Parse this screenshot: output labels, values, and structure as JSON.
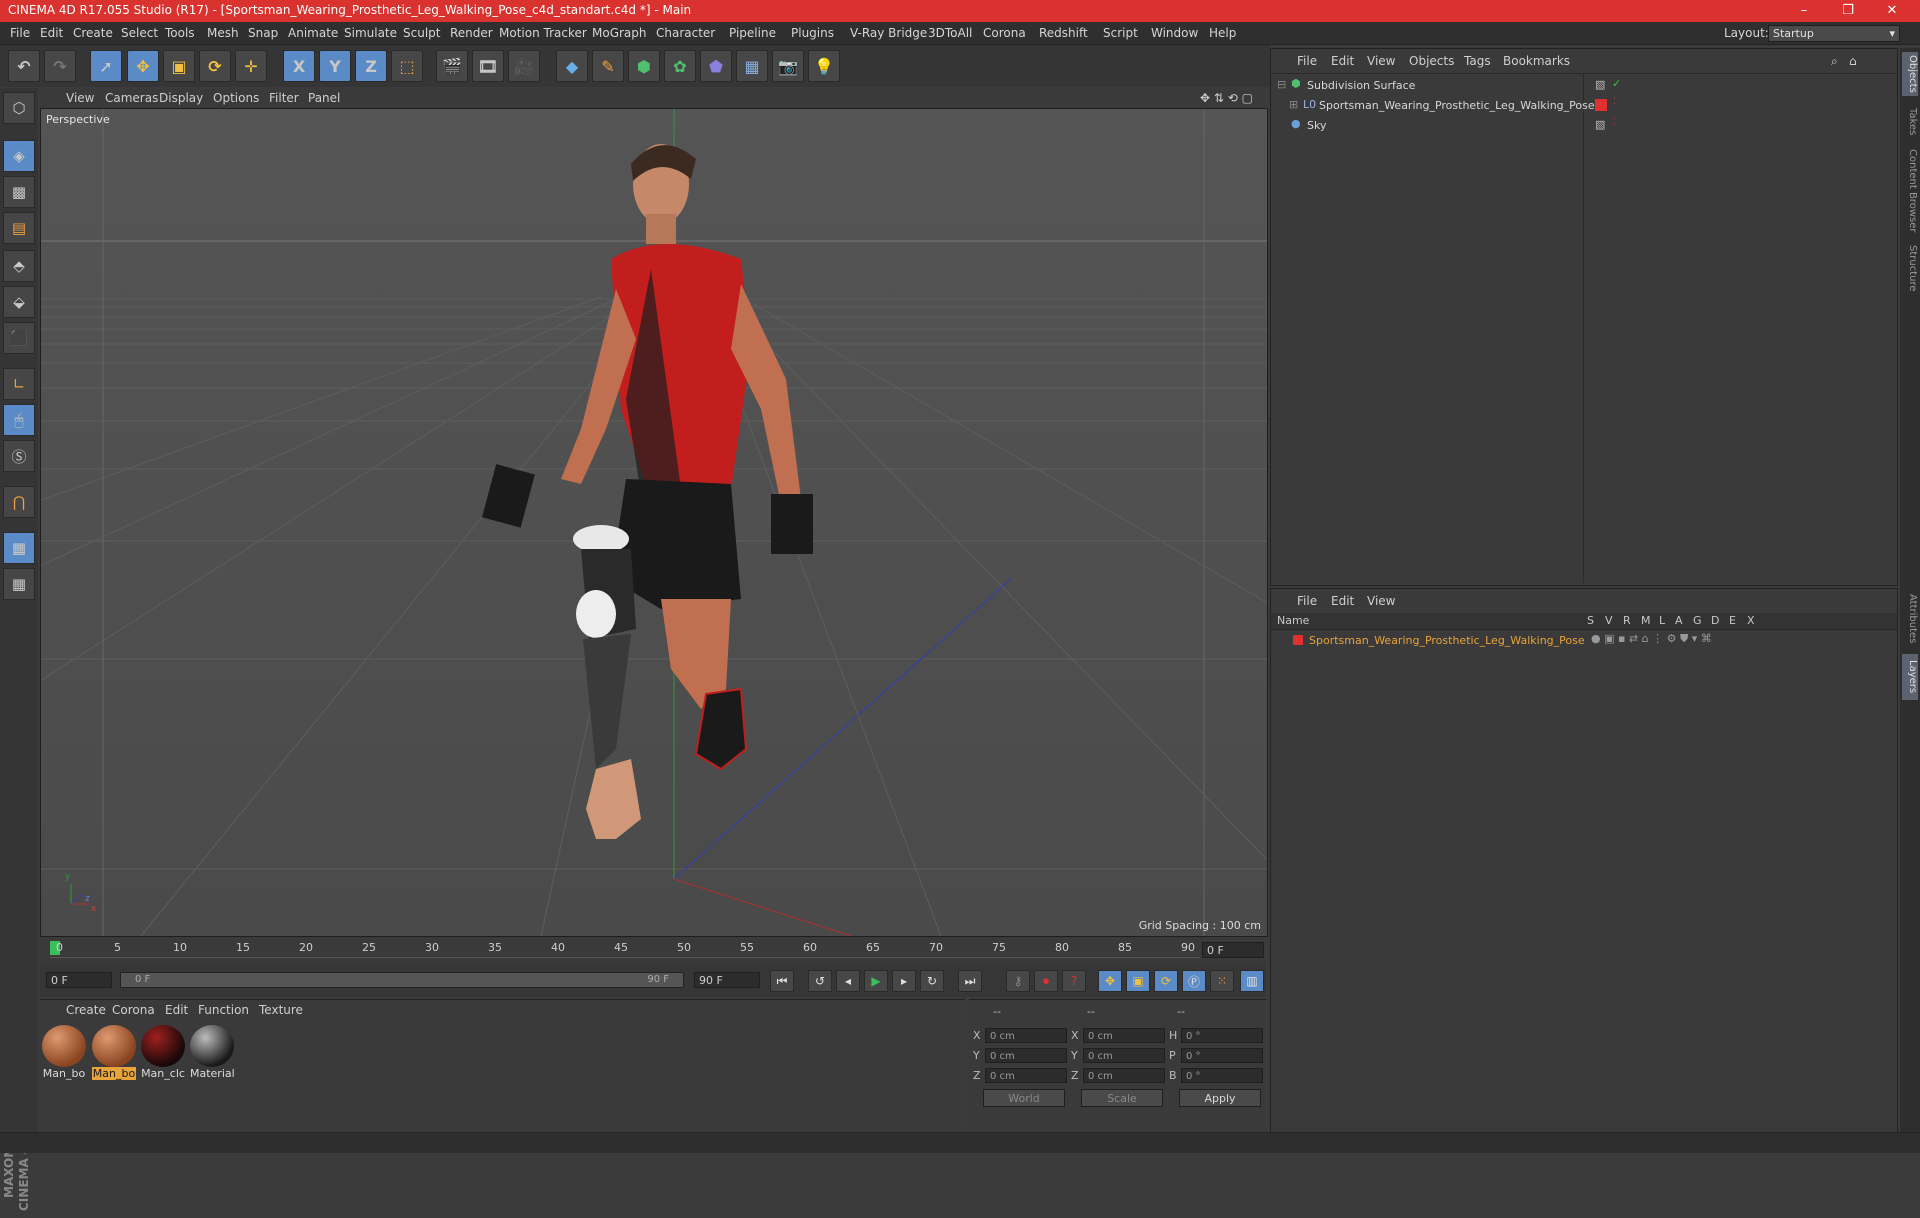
{
  "window": {
    "title": "CINEMA 4D R17.055 Studio (R17) - [Sportsman_Wearing_Prosthetic_Leg_Walking_Pose_c4d_standart.c4d *] - Main",
    "minimize": "–",
    "maximize": "❐",
    "close": "✕"
  },
  "menu": {
    "items": [
      "File",
      "Edit",
      "Create",
      "Select",
      "Tools",
      "Mesh",
      "Snap",
      "Animate",
      "Simulate",
      "Sculpt",
      "Render",
      "Motion Tracker",
      "MoGraph",
      "Character",
      "Pipeline",
      "Plugins",
      "V-Ray Bridge",
      "3DToAll",
      "Corona",
      "Redshift",
      "Script",
      "Window",
      "Help"
    ],
    "layout_label": "Layout:",
    "layout_value": "Startup"
  },
  "toolbar": {
    "axis_x": "X",
    "axis_y": "Y",
    "axis_z": "Z"
  },
  "viewport": {
    "menu": [
      "View",
      "Cameras",
      "Display",
      "Options",
      "Filter",
      "Panel"
    ],
    "label": "Perspective",
    "grid_spacing": "Grid Spacing : 100 cm",
    "axis_y": "y",
    "axis_z": "z",
    "axis_x": "x"
  },
  "timeline": {
    "ticks": [
      "0",
      "5",
      "10",
      "15",
      "20",
      "25",
      "30",
      "35",
      "40",
      "45",
      "50",
      "55",
      "60",
      "65",
      "70",
      "75",
      "80",
      "85",
      "90"
    ],
    "current_frame": "0 F"
  },
  "transport": {
    "start_field": "0 F",
    "range_start": "0 F",
    "range_end": "90 F",
    "end_field": "90 F"
  },
  "materials": {
    "menu": [
      "Create",
      "Corona",
      "Edit",
      "Function",
      "Texture"
    ],
    "items": [
      {
        "label": "Man_bo",
        "selected": false,
        "color": "#b0603a"
      },
      {
        "label": "Man_bo",
        "selected": true,
        "color": "#b0603a"
      },
      {
        "label": "Man_clc",
        "selected": false,
        "color": "#3a1010"
      },
      {
        "label": "Material",
        "selected": false,
        "color": "#2a2a2a"
      }
    ]
  },
  "coordinates": {
    "headers": [
      "--",
      "--",
      "--"
    ],
    "rows": [
      {
        "l1": "X",
        "v1": "0 cm",
        "l2": "X",
        "v2": "0 cm",
        "l3": "H",
        "v3": "0 °"
      },
      {
        "l1": "Y",
        "v1": "0 cm",
        "l2": "Y",
        "v2": "0 cm",
        "l3": "P",
        "v3": "0 °"
      },
      {
        "l1": "Z",
        "v1": "0 cm",
        "l2": "Z",
        "v2": "0 cm",
        "l3": "B",
        "v3": "0 °"
      }
    ],
    "world": "World",
    "scale": "Scale",
    "apply": "Apply"
  },
  "object_manager": {
    "menu": [
      "File",
      "Edit",
      "View",
      "Objects",
      "Tags",
      "Bookmarks"
    ],
    "objects": [
      {
        "name": "Subdivision Surface",
        "color": "#6ab04c"
      },
      {
        "name": "Sportsman_Wearing_Prosthetic_Leg_Walking_Pose",
        "color": "#e03030"
      },
      {
        "name": "Sky",
        "color": "#6aa0d8"
      }
    ]
  },
  "layer_manager": {
    "menu": [
      "File",
      "Edit",
      "View"
    ],
    "columns": [
      "Name",
      "S",
      "V",
      "R",
      "M",
      "L",
      "A",
      "G",
      "D",
      "E",
      "X"
    ],
    "layers": [
      {
        "name": "Sportsman_Wearing_Prosthetic_Leg_Walking_Pose",
        "color": "#e8a33a"
      }
    ]
  },
  "right_tabs": [
    "Objects",
    "Takes",
    "Content Browser",
    "Structure",
    "Attributes",
    "Layers"
  ],
  "maxon_logo": "MAXON CINEMA 4D"
}
